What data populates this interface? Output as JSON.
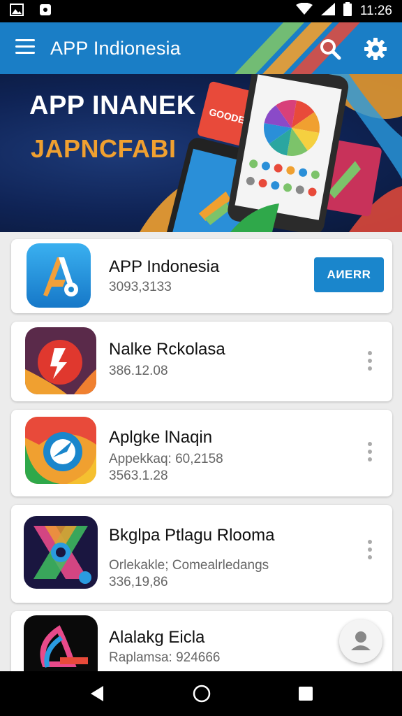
{
  "status_bar": {
    "time": "11:26",
    "icons": [
      "gallery-icon",
      "notification-icon",
      "wifi-icon",
      "signal-icon",
      "battery-icon"
    ]
  },
  "app_bar": {
    "title": "APP Indionesia",
    "icons": [
      "menu-icon",
      "search-icon",
      "settings-icon"
    ],
    "color": "#1a7ec6"
  },
  "banner": {
    "title": "APP INANEK",
    "subtitle": "JAPNCFABI",
    "badge_text": "GOODEE",
    "title_color": "#ffffff",
    "subtitle_color": "#f0a030"
  },
  "apps": [
    {
      "name": "APP Indonesia",
      "meta": "3093,3133",
      "action_label": "AИERR",
      "icon": "letter-a-app-icon"
    },
    {
      "name": "Nalke Rckolasa",
      "meta": "386.12.08",
      "icon": "red-app-icon"
    },
    {
      "name": "Aplgke lNaqin",
      "meta": "Appekkaq: 60,2158",
      "meta2": "3563.1.28",
      "icon": "chrome-like-app-icon"
    },
    {
      "name": "Bkglpa Ptlagu Rlooma",
      "meta": "Orlekakle; Comealrledangs",
      "meta2": "336,19,86",
      "icon": "colorful-x-app-icon"
    },
    {
      "name": "Alalakg Eicla",
      "meta": "Raplamsa: 924666",
      "icon": "dark-swirl-app-icon"
    }
  ],
  "colors": {
    "accent": "#1a86cc",
    "background": "#ececec"
  }
}
